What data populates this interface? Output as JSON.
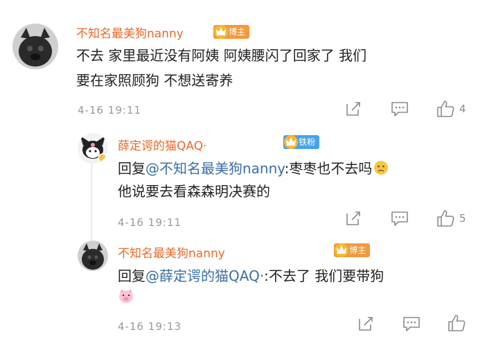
{
  "comments": [
    {
      "username": "不知名最美狗nanny",
      "badge": "博主",
      "line1": "不去 家里最近没有阿姨 阿姨腰闪了回家了 我们",
      "line2": "要在家照顾狗 不想送寄养",
      "time": "4-16 19:11",
      "likes": "4"
    },
    {
      "username": "薛定谔的猫QAQ·",
      "badge": "铁粉",
      "reply_prefix": "回复",
      "mention": "@不知名最美狗nanny",
      "line1_rest": ":枣枣也不去吗",
      "line2": "他说要去看森森明决赛的",
      "time": "4-16 19:11",
      "likes": "5"
    },
    {
      "username": "不知名最美狗nanny",
      "badge": "博主",
      "reply_prefix": "回复",
      "mention": "@薛定谔的猫QAQ·",
      "line1_rest": ":不去了 我们要带狗",
      "time": "4-16 19:13"
    }
  ],
  "colors": {
    "username": "#e86a2a",
    "mention": "#3a6ea5",
    "badge_owner": "#f19a3e",
    "badge_fan": "#4aa2e8"
  },
  "icons": [
    "share-icon",
    "comment-icon",
    "like-icon",
    "crown-icon",
    "emoji-icon",
    "pig-emoji-icon"
  ]
}
